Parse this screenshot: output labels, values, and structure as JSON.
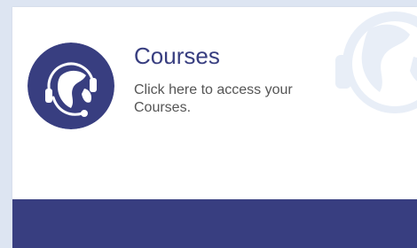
{
  "card": {
    "title": "Courses",
    "description": "Click here to access your Courses.",
    "icon": "globe-headset-icon",
    "watermark_icon": "globe-headset-icon"
  },
  "colors": {
    "brand": "#383e80",
    "title_text": "#383e80",
    "body_text": "#555555",
    "watermark": "#e8eef7",
    "page_background": "#dde5f2",
    "card_background": "#ffffff"
  }
}
